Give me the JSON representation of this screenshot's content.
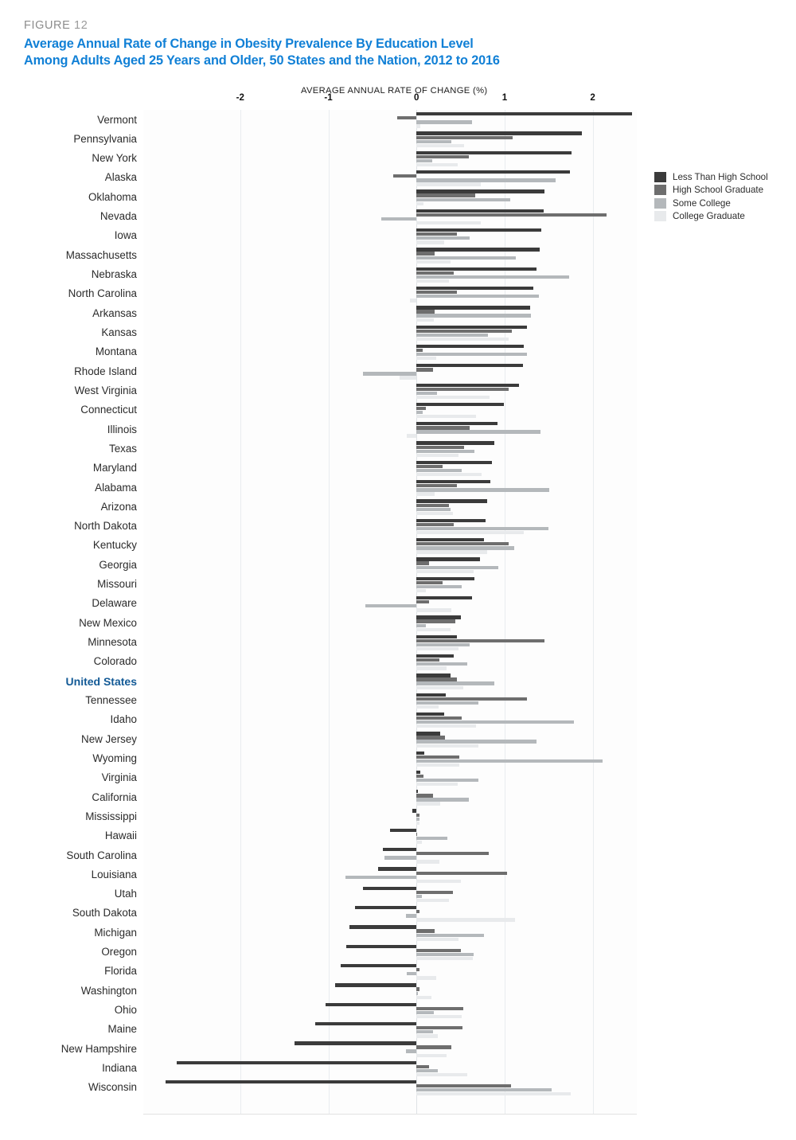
{
  "figure": {
    "label": "FIGURE",
    "number": "12"
  },
  "title": {
    "line1": "Average Annual Rate of Change in Obesity Prevalence By Education Level",
    "line2": "Among Adults Aged 25 Years and Older, 50 States and the Nation, 2012 to 2016",
    "color": "#1180d6"
  },
  "legend": {
    "items": [
      {
        "label": "Less Than High School",
        "color": "#3b3b3b"
      },
      {
        "label": "High School Graduate",
        "color": "#6e6e6e"
      },
      {
        "label": "Some College",
        "color": "#b4b8bb"
      },
      {
        "label": "College Graduate",
        "color": "#e8eaec"
      }
    ]
  },
  "highlight_row": "United States",
  "chart_data": {
    "type": "bar",
    "orientation": "horizontal",
    "title": "Average Annual Rate of Change in Obesity Prevalence By Education Level Among Adults Aged 25 Years and Older, 50 States and the Nation, 2012 to 2016",
    "xlabel": "AVERAGE ANNUAL RATE OF CHANGE (%)",
    "ylabel": "",
    "xlim": [
      -3.1,
      2.5
    ],
    "xticks": [
      -2,
      -1,
      0,
      1,
      2
    ],
    "xticklabels": [
      "-2",
      "-1",
      "0",
      "1",
      "2"
    ],
    "grid": "vertical",
    "legend_position": "right",
    "series_names": [
      "Less Than High School",
      "High School Graduate",
      "Some College",
      "College Graduate"
    ],
    "categories": [
      "Vermont",
      "Pennsylvania",
      "New York",
      "Alaska",
      "Oklahoma",
      "Nevada",
      "Iowa",
      "Massachusetts",
      "Nebraska",
      "North Carolina",
      "Arkansas",
      "Kansas",
      "Montana",
      "Rhode Island",
      "West Virginia",
      "Connecticut",
      "Illinois",
      "Texas",
      "Maryland",
      "Alabama",
      "Arizona",
      "North Dakota",
      "Kentucky",
      "Georgia",
      "Missouri",
      "Delaware",
      "New Mexico",
      "Minnesota",
      "Colorado",
      "United States",
      "Tennessee",
      "Idaho",
      "New Jersey",
      "Wyoming",
      "Virginia",
      "California",
      "Mississippi",
      "Hawaii",
      "South Carolina",
      "Louisiana",
      "Utah",
      "South Dakota",
      "Michigan",
      "Oregon",
      "Florida",
      "Washington",
      "Ohio",
      "Maine",
      "New Hampshire",
      "Indiana",
      "Wisconsin"
    ],
    "series": [
      {
        "name": "Less Than High School",
        "color": "#3b3b3b",
        "values": [
          2.45,
          1.88,
          1.76,
          1.74,
          1.45,
          1.44,
          1.42,
          1.4,
          1.36,
          1.33,
          1.29,
          1.25,
          1.22,
          1.21,
          1.16,
          0.99,
          0.92,
          0.88,
          0.86,
          0.84,
          0.8,
          0.78,
          0.77,
          0.72,
          0.66,
          0.63,
          0.5,
          0.46,
          0.42,
          0.39,
          0.33,
          0.31,
          0.27,
          0.09,
          0.04,
          0.02,
          -0.05,
          -0.3,
          -0.38,
          -0.44,
          -0.61,
          -0.7,
          -0.76,
          -0.8,
          -0.86,
          -0.92,
          -1.03,
          -1.15,
          -1.38,
          -2.72,
          -2.85
        ]
      },
      {
        "name": "High School Graduate",
        "color": "#6e6e6e",
        "values": [
          -0.22,
          1.09,
          0.59,
          -0.26,
          0.67,
          2.16,
          0.46,
          0.21,
          0.42,
          0.46,
          0.21,
          1.08,
          0.07,
          0.19,
          1.05,
          0.11,
          0.6,
          0.54,
          0.3,
          0.46,
          0.37,
          0.42,
          1.05,
          0.14,
          0.3,
          0.14,
          0.44,
          1.45,
          0.26,
          0.46,
          1.25,
          0.51,
          0.32,
          0.49,
          0.08,
          0.19,
          0.03,
          0.01,
          0.82,
          1.03,
          0.41,
          0.03,
          0.21,
          0.5,
          0.03,
          0.03,
          0.53,
          0.52,
          0.4,
          0.14,
          1.07
        ]
      },
      {
        "name": "Some College",
        "color": "#b4b8bb",
        "values": [
          0.63,
          0.4,
          0.18,
          1.58,
          1.06,
          -0.4,
          0.6,
          1.13,
          1.73,
          1.39,
          1.3,
          0.81,
          1.25,
          -0.61,
          0.23,
          0.07,
          1.41,
          0.66,
          0.51,
          1.51,
          0.39,
          1.5,
          1.11,
          0.93,
          0.51,
          -0.58,
          0.11,
          0.6,
          0.58,
          0.88,
          0.7,
          1.79,
          1.36,
          2.11,
          0.7,
          0.59,
          0.03,
          0.35,
          -0.36,
          -0.81,
          0.06,
          -0.12,
          0.77,
          0.65,
          -0.11,
          0.02,
          0.2,
          0.19,
          -0.12,
          0.24,
          1.53
        ]
      },
      {
        "name": "College Graduate",
        "color": "#e8eaec",
        "values": [
          0.04,
          0.54,
          0.47,
          0.73,
          0.08,
          0.73,
          0.31,
          0.39,
          0.37,
          -0.07,
          0.2,
          1.05,
          0.22,
          -0.19,
          0.83,
          0.68,
          -0.11,
          0.48,
          0.74,
          0.21,
          0.41,
          1.22,
          0.8,
          0.65,
          0.11,
          0.4,
          0.39,
          0.48,
          0.34,
          0.53,
          0.25,
          0.68,
          0.7,
          0.49,
          0.47,
          0.27,
          0.03,
          0.06,
          0.26,
          0.5,
          0.37,
          1.12,
          0.48,
          0.64,
          0.22,
          0.17,
          0.51,
          0.24,
          0.34,
          0.58,
          1.75
        ]
      }
    ]
  }
}
